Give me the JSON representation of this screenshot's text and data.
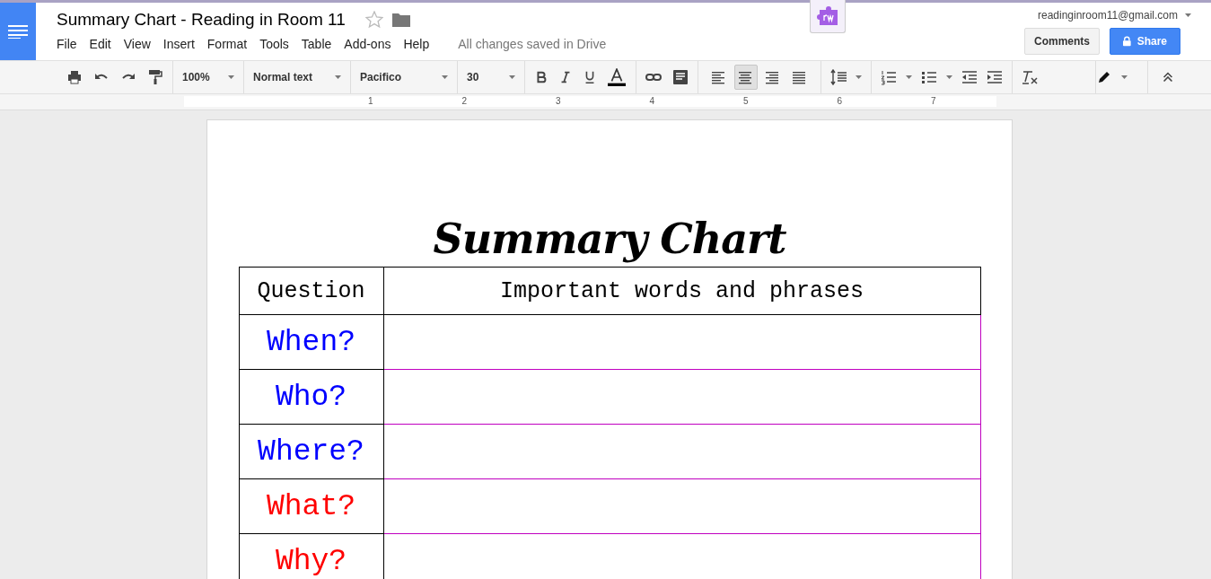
{
  "document": {
    "title": "Summary Chart - Reading in Room 11",
    "starred": false
  },
  "menu": [
    "File",
    "Edit",
    "View",
    "Insert",
    "Format",
    "Tools",
    "Table",
    "Add-ons",
    "Help"
  ],
  "save_status": "All changes saved in Drive",
  "account": "readinginroom11@gmail.com",
  "buttons": {
    "comments": "Comments",
    "share": "Share"
  },
  "toolbar": {
    "zoom": "100%",
    "style": "Normal text",
    "font": "Pacifico",
    "size": "30",
    "alignment": [
      {
        "selected": false
      },
      {
        "selected": true
      },
      {
        "selected": false
      },
      {
        "selected": false
      }
    ]
  },
  "ruler": [
    "1",
    "2",
    "3",
    "4",
    "5",
    "6",
    "7"
  ],
  "page": {
    "heading": "Summary Chart",
    "table": {
      "columns": [
        "Question",
        "Important words and phrases"
      ],
      "rows": [
        {
          "question": "When?",
          "color": "#0000ff"
        },
        {
          "question": "Who?",
          "color": "#0000ff"
        },
        {
          "question": "Where?",
          "color": "#0000ff"
        },
        {
          "question": "What?",
          "color": "#ff0000"
        },
        {
          "question": "Why?",
          "color": "#ff0000"
        }
      ]
    }
  }
}
